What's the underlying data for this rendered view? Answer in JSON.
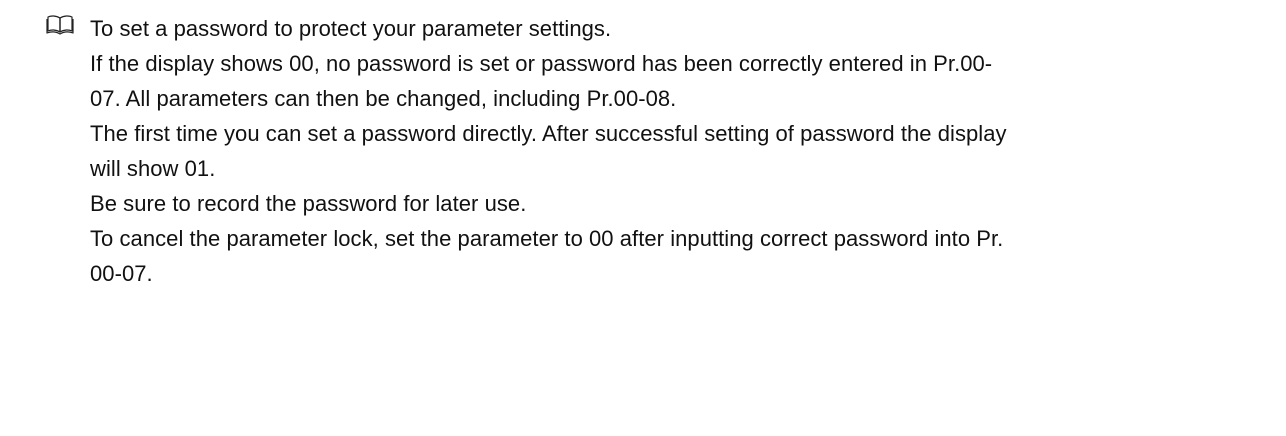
{
  "note": {
    "icon": "open-book-icon",
    "lines": [
      "To set a password to protect your parameter settings.",
      "If the display shows 00, no password is set or password has been correctly entered in Pr.00-",
      "07. All parameters can then be changed, including Pr.00-08.",
      "The first time you can set a password directly. After successful setting of password the display",
      "will show 01.",
      "Be sure to record the password for later use.",
      "To cancel the parameter lock, set the parameter to 00 after inputting correct password into Pr.",
      "00-07."
    ]
  }
}
